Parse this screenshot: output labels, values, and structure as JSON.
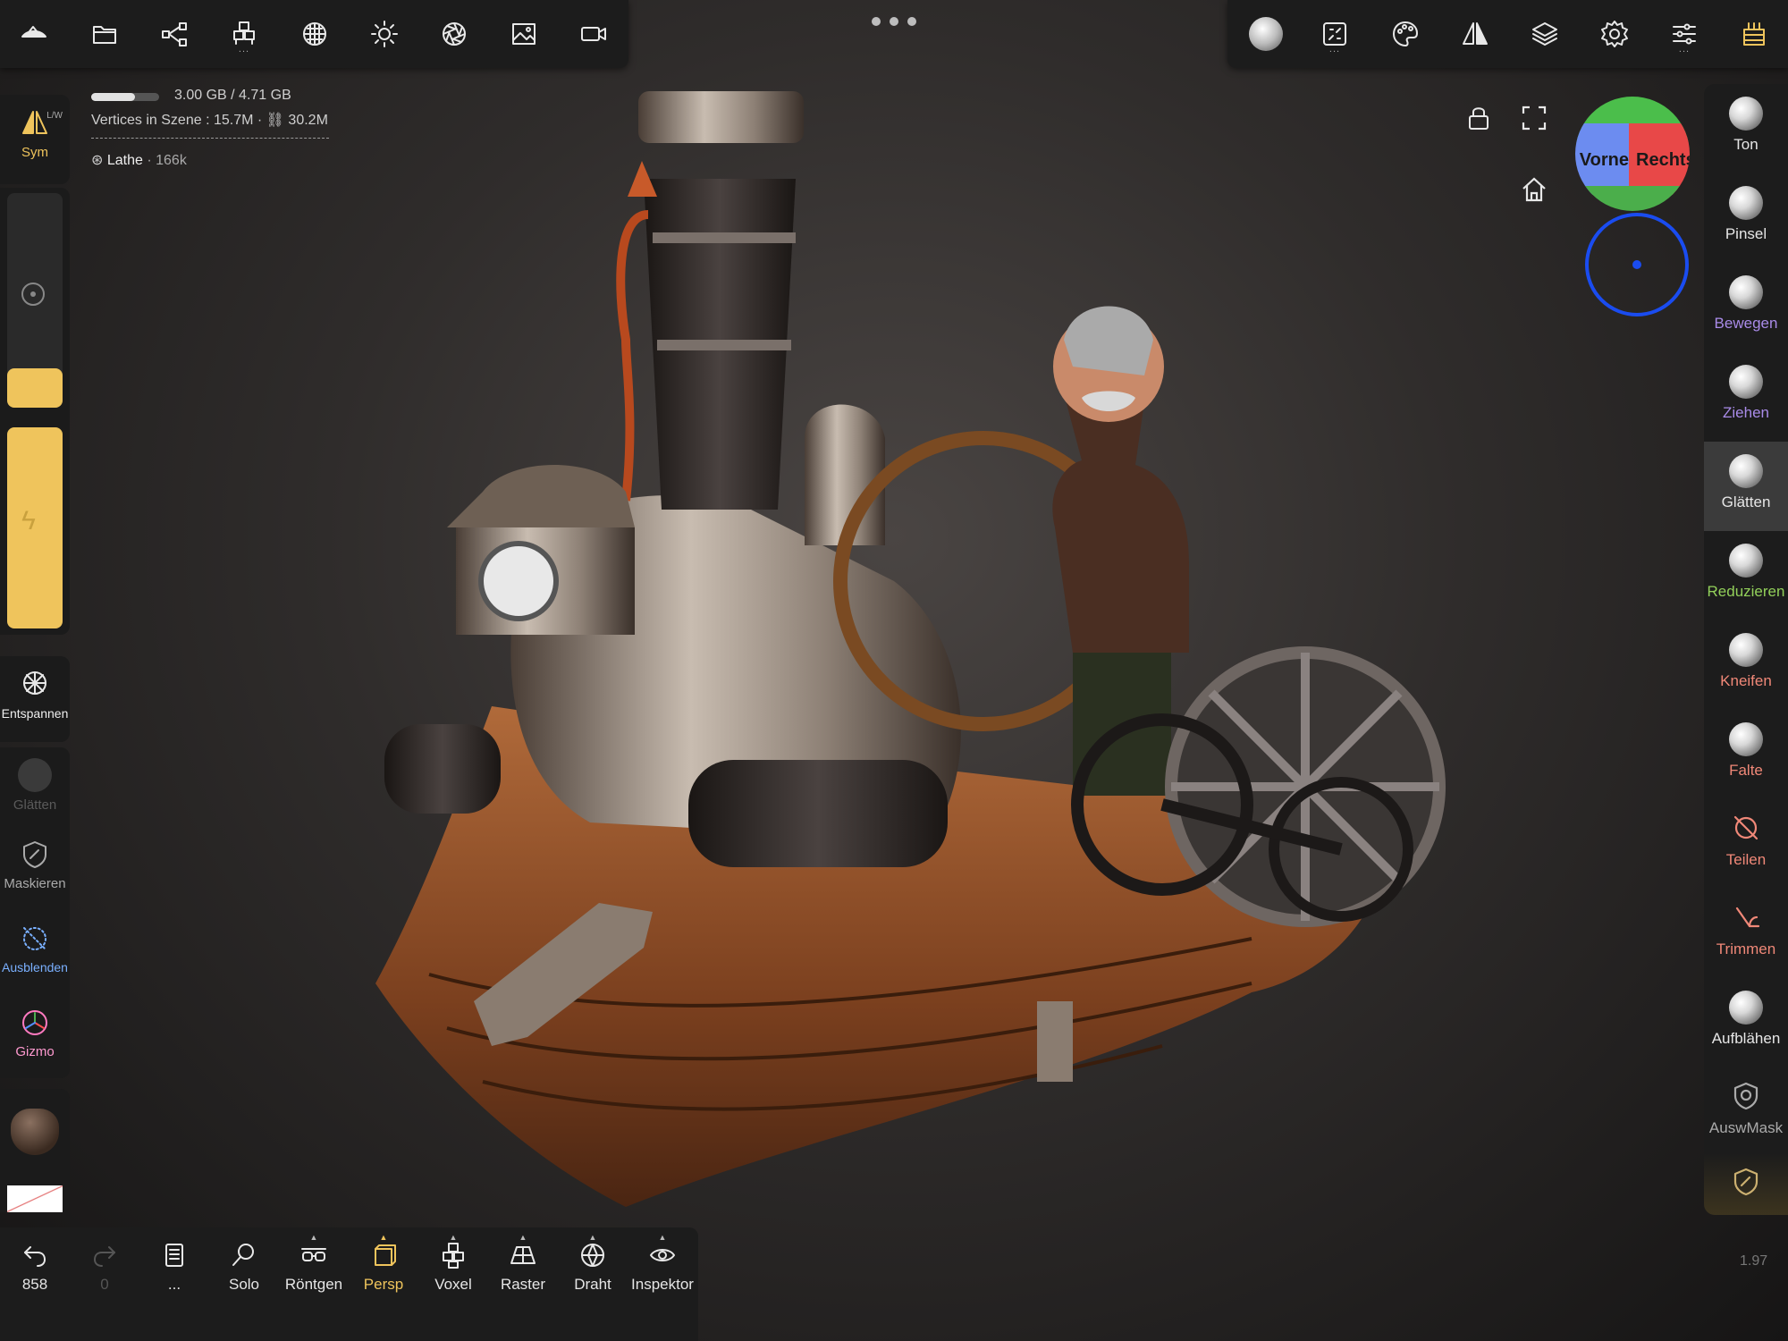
{
  "top_toolbar": {
    "left_tools": [
      "app-menu",
      "files",
      "scene",
      "shapes",
      "materials",
      "lighting",
      "post-process",
      "background",
      "camera"
    ],
    "right_tools": [
      "brush-settings",
      "painting",
      "palette",
      "symmetry",
      "layers",
      "settings",
      "interface",
      "store"
    ]
  },
  "info": {
    "memory": "3.00 GB / 4.71 GB",
    "memory_fraction": 0.64,
    "vertices": "Vertices in Szene : 15.7M · ",
    "vertices_linked": "30.2M",
    "object_name": "Lathe",
    "object_count": " · 166k"
  },
  "left_sidebar": {
    "sym_label": "Sym",
    "sym_badge": "L/W",
    "radius_fraction": 0.3,
    "intensity_fraction": 1.0,
    "entspannen_label": "Entspannen",
    "glaetten_label": "Glätten",
    "maskieren_label": "Maskieren",
    "ausblenden_label": "Ausblenden",
    "gizmo_label": "Gizmo"
  },
  "right_sidebar": {
    "tools": [
      {
        "label": "Ton",
        "color": "#e6e6e6"
      },
      {
        "label": "Pinsel",
        "color": "#e6e6e6"
      },
      {
        "label": "Bewegen",
        "color": "#a98be8"
      },
      {
        "label": "Ziehen",
        "color": "#a98be8"
      },
      {
        "label": "Glätten",
        "color": "#e6e6e6"
      },
      {
        "label": "Reduzieren",
        "color": "#92d05a"
      },
      {
        "label": "Kneifen",
        "color": "#f08878"
      },
      {
        "label": "Falte",
        "color": "#f08878"
      },
      {
        "label": "Teilen",
        "color": "#f08878"
      },
      {
        "label": "Trimmen",
        "color": "#f08878"
      },
      {
        "label": "Aufblähen",
        "color": "#e6e6e6"
      },
      {
        "label": "AuswMask",
        "color": "#aaaaaa"
      }
    ],
    "active_tool": "Glätten"
  },
  "viewcube": {
    "front_label": "Vorne",
    "right_label": "Rechts"
  },
  "bottom_bar": {
    "undo_count": "858",
    "redo_count": "0",
    "history_label": "...",
    "solo_label": "Solo",
    "xray_label": "Röntgen",
    "persp_label": "Persp",
    "voxel_label": "Voxel",
    "raster_label": "Raster",
    "wireframe_label": "Draht",
    "inspector_label": "Inspektor"
  },
  "version": "1.97",
  "colors": {
    "accent": "#efc45c",
    "panel": "#1c1c1c",
    "viewport_bg": "#2f2c2b"
  }
}
